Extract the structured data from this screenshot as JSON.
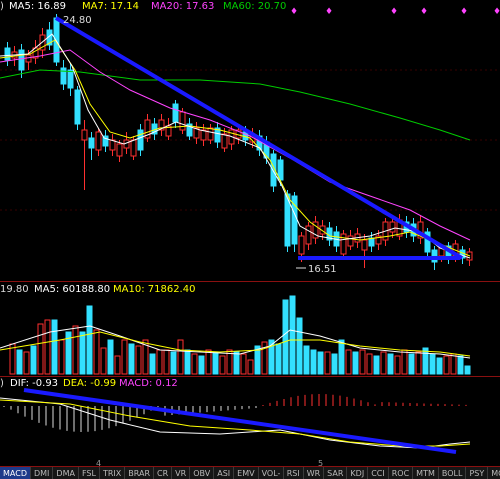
{
  "price_panel": {
    "prefix": ")",
    "ma5": "MA5: 16.89",
    "ma7": "MA7: 17.14",
    "ma20": "MA20: 17.63",
    "ma60": "MA60: 20.70",
    "high_label": "24.80",
    "low_label": "16.51",
    "colors": {
      "ma5": "#ffffff",
      "ma7": "#ffff00",
      "ma20": "#ff44ff",
      "ma60": "#00cc00",
      "up": "#ff3030",
      "down": "#33e0ff",
      "trend": "#1a1aff"
    }
  },
  "volume_panel": {
    "prefix": "19.80",
    "ma5": "MA5: 60188.80",
    "ma10": "MA10: 71862.40"
  },
  "macd_panel": {
    "prefix": ")",
    "dif": "DIF: -0.93",
    "dea": "DEA: -0.99",
    "macd": "MACD: 0.12"
  },
  "axis": {
    "month_4": "4",
    "month_5": "5"
  },
  "tabs": [
    "MACD",
    "DMI",
    "DMA",
    "FSL",
    "TRIX",
    "BRAR",
    "CR",
    "VR",
    "OBV",
    "ASI",
    "EMV",
    "VOL-TDX",
    "RSI",
    "WR",
    "SAR",
    "KDJ",
    "CCI",
    "ROC",
    "MTM",
    "BOLL",
    "PSY",
    "MCST"
  ],
  "active_tab": "MACD"
}
